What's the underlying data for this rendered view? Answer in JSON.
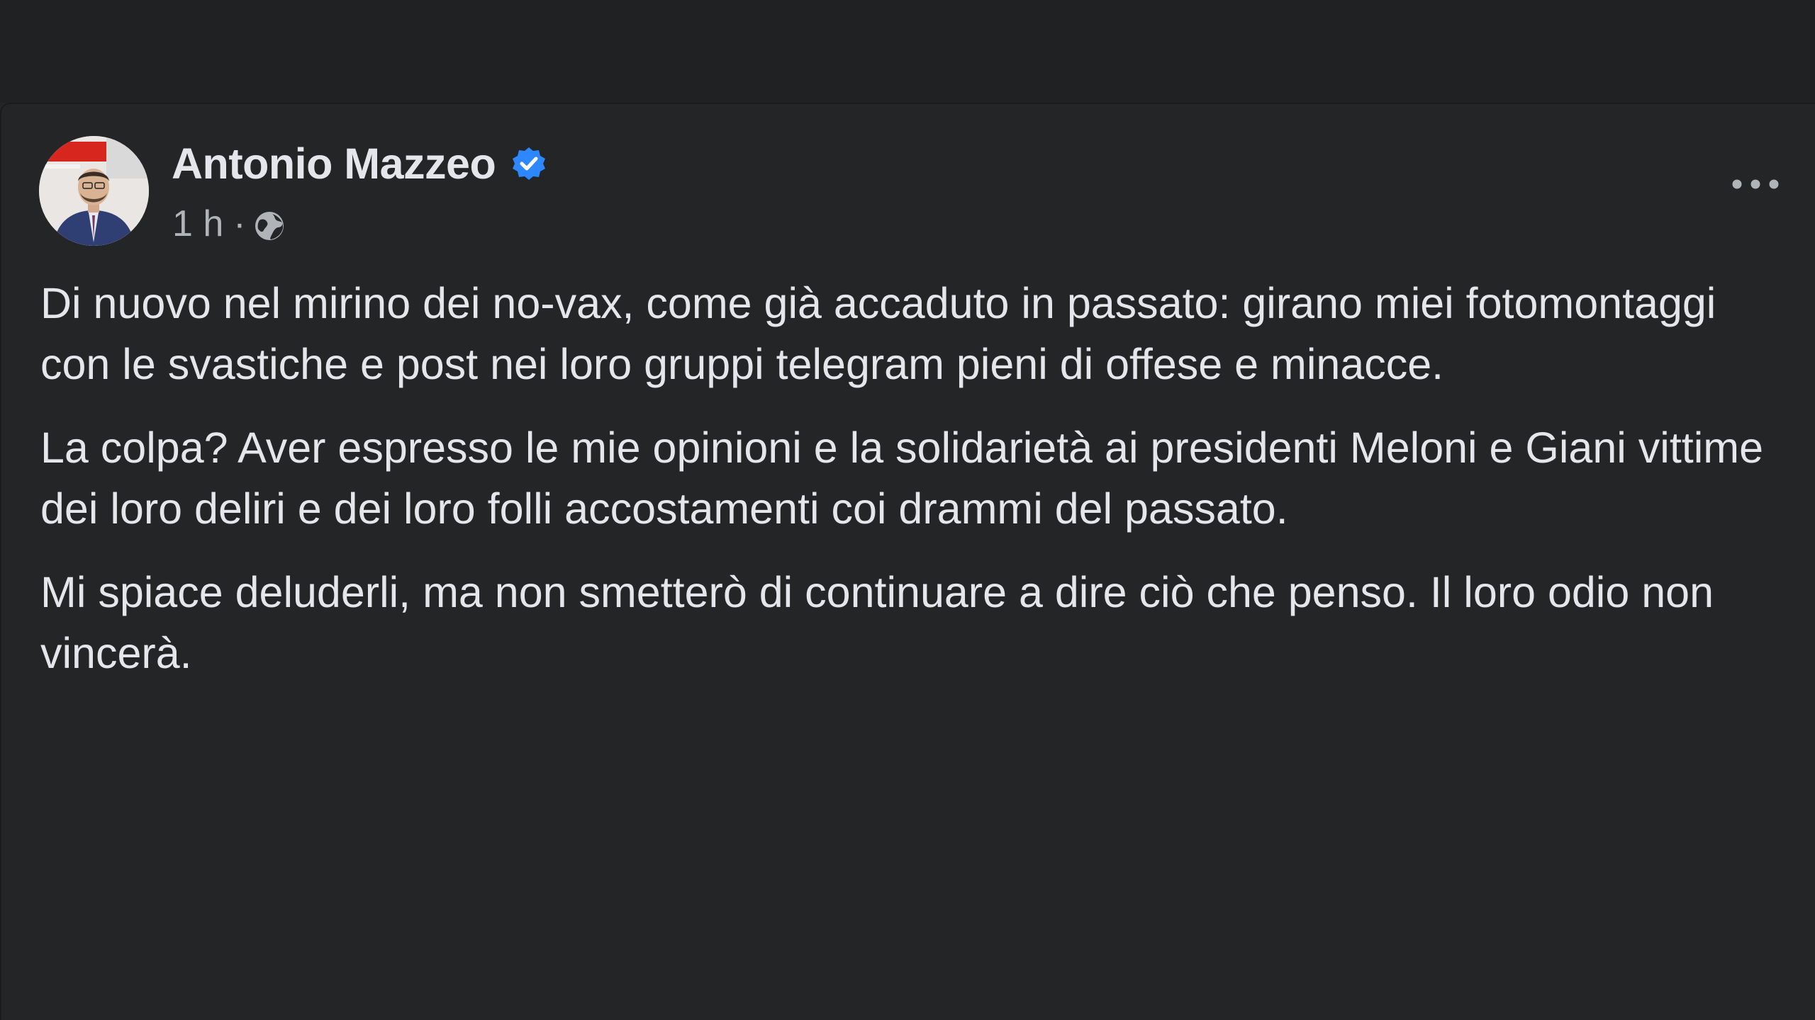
{
  "post": {
    "author": "Antonio Mazzeo",
    "time": "1 h",
    "separator": "·",
    "paragraphs": [
      "Di nuovo nel mirino dei no-vax, come già accaduto in passato: girano miei fotomontaggi con le svastiche e post nei loro gruppi telegram pieni di offese e minacce.",
      "La colpa? Aver espresso le mie opinioni e la solidarietà ai presidenti Meloni e Giani vittime dei loro deliri e dei loro folli accostamenti coi drammi del passato.",
      "Mi spiace deluderli, ma non smetterò di continuare a dire ciò che penso. Il loro odio non vincerà."
    ]
  },
  "icons": {
    "verified": "verified-badge-icon",
    "audience": "globe-icon",
    "menu": "more-options-icon"
  },
  "colors": {
    "background": "#242526",
    "top_bar": "#202123",
    "text_primary": "#e4e6eb",
    "text_secondary": "#b0b3b8",
    "verified_blue": "#2d88ff"
  }
}
